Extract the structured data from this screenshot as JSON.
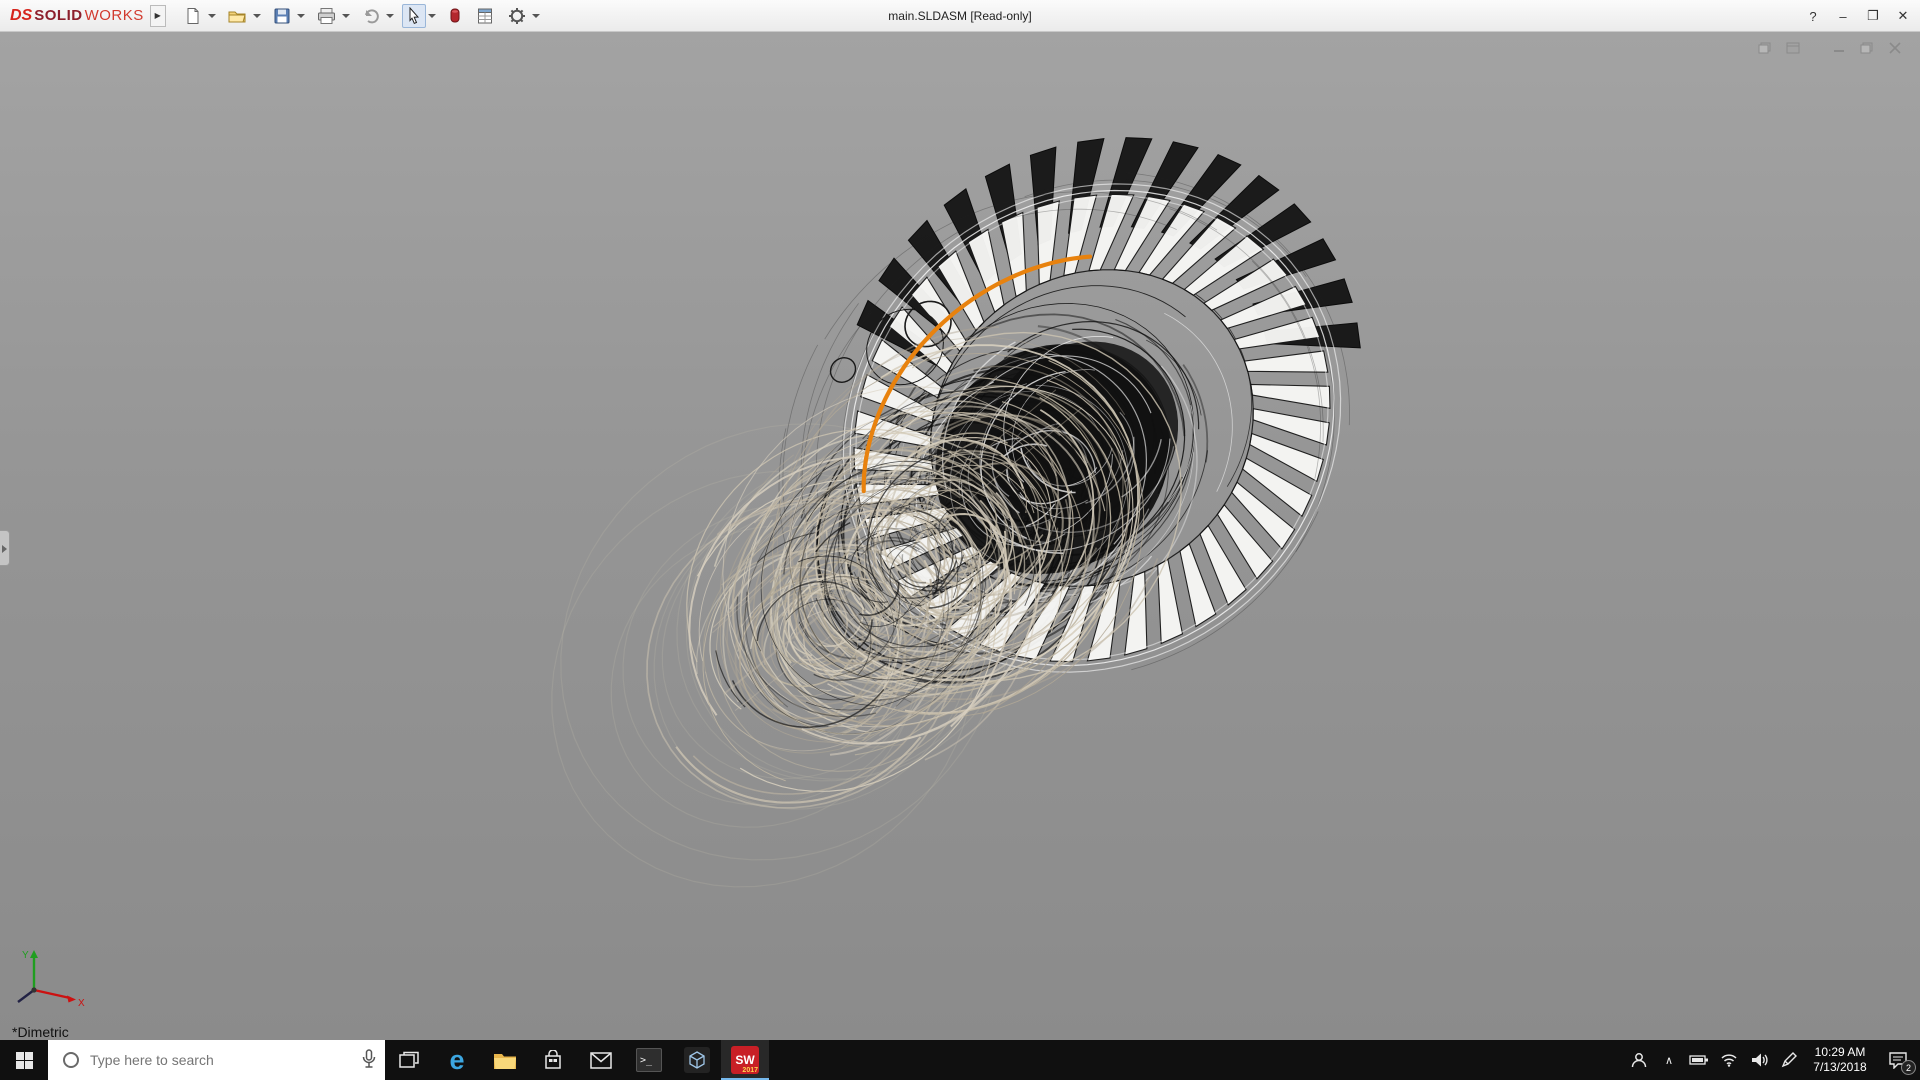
{
  "window": {
    "brand_ds": "DS",
    "brand_solid": "SOLID",
    "brand_works": "WORKS",
    "title": "main.SLDASM [Read-only]"
  },
  "icons": {
    "flyout": "▶",
    "help": "?",
    "minimize": "–",
    "restore": "❐",
    "close": "✕",
    "edge": "e",
    "chevron_up": "∧",
    "cmd": ">_"
  },
  "toolbar": {
    "icon_names": [
      "new-document-icon",
      "open-icon",
      "save-icon",
      "print-icon",
      "undo-icon",
      "select-arrow-icon",
      "red-cylinder-icon",
      "report-icon",
      "options-gear-icon"
    ]
  },
  "viewport": {
    "view_label": "*Dimetric",
    "selection_color": "#e8820e",
    "triad": {
      "x": "X",
      "y": "Y"
    }
  },
  "taskbar": {
    "search": {
      "placeholder": "Type here to search"
    },
    "apps": {
      "solidworks": {
        "label": "SW",
        "year": "2017"
      }
    },
    "clock": {
      "time": "10:29 AM",
      "date": "7/13/2018"
    },
    "notifications": {
      "badge": "2"
    }
  }
}
